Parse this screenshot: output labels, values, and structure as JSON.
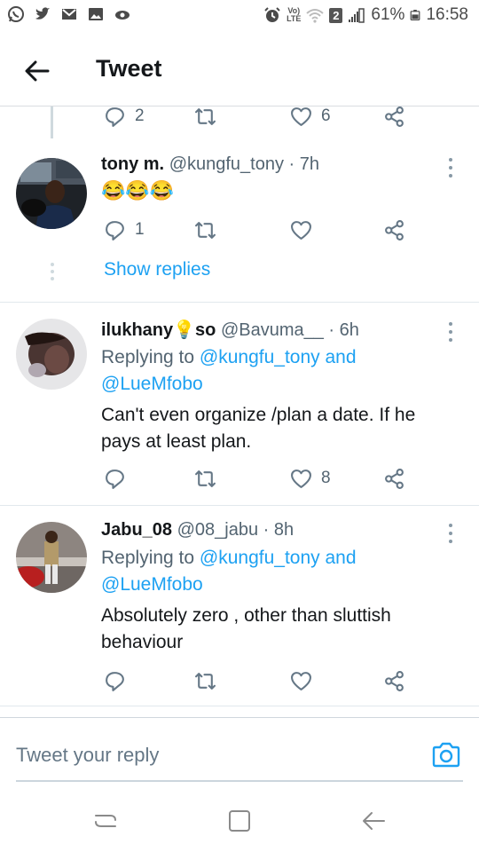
{
  "status_bar": {
    "battery_percent": "61%",
    "time": "16:58",
    "sim_badge": "2",
    "volte_top": "Vo)",
    "volte_bottom": "LTE",
    "left_icons": [
      "whatsapp-icon",
      "twitter-icon",
      "gmail-icon",
      "gallery-icon",
      "cloud-icon"
    ],
    "right_icons": [
      "alarm-icon",
      "volte-icon",
      "wifi-icon",
      "signal-icon",
      "battery-icon"
    ]
  },
  "app_bar": {
    "title": "Tweet",
    "back_icon": "arrow-left-icon"
  },
  "top_actions": {
    "reply_count": "2",
    "like_count": "6"
  },
  "tweets": [
    {
      "name": "tony m.",
      "handle": "@kungfu_tony · 7h",
      "body": "😂😂😂",
      "reply_count": "1",
      "like_count": ""
    },
    {
      "name": "ilukhany💡so",
      "handle": "@Bavuma__ · 6h",
      "replying_prefix": "Replying to ",
      "replying_user_1": "@kungfu_tony and",
      "replying_user_2": "@LueMfobo",
      "body": "Can't even organize /plan a date. If he pays at least plan.",
      "like_count": "8"
    },
    {
      "name": "Jabu_08",
      "handle": "@08_jabu · 8h",
      "replying_prefix": "Replying to ",
      "replying_user_1": "@kungfu_tony and",
      "replying_user_2": "@LueMfobo",
      "body": "Absolutely zero , other than sluttish behaviour",
      "like_count": ""
    }
  ],
  "show_replies": "Show replies",
  "composer": {
    "placeholder": "Tweet your reply",
    "camera_icon": "camera-icon"
  },
  "nav_bar": {
    "icons": [
      "recent-apps-icon",
      "home-icon",
      "back-icon"
    ]
  },
  "colors": {
    "accent": "#1da1f2",
    "secondary_text": "#536471",
    "divider": "#e1e8ed"
  }
}
